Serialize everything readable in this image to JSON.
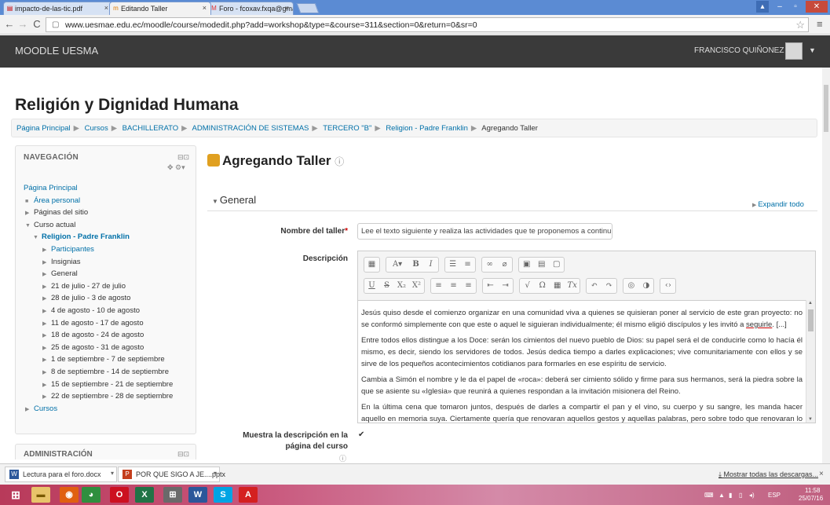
{
  "browser": {
    "tabs": [
      {
        "label": "impacto-de-las-tic.pdf",
        "icon": "pdf-icon"
      },
      {
        "label": "Editando Taller",
        "icon": "moodle-icon"
      },
      {
        "label": "Foro - fcoxav.fxqa@gmail",
        "icon": "gmail-icon"
      }
    ],
    "url": "www.uesmae.edu.ec/moodle/course/modedit.php?add=workshop&type=&course=311&section=0&return=0&sr=0",
    "close_glyph": "×"
  },
  "header": {
    "brand": "MOODLE UESMA",
    "user_name": "FRANCISCO QUIÑONEZ"
  },
  "course_title": "Religión y Dignidad Humana",
  "breadcrumb": [
    "Página Principal",
    "Cursos",
    "BACHILLERATO",
    "ADMINISTRACIÓN DE SISTEMAS",
    "TERCERO \"B\"",
    "Religion - Padre Franklin",
    "Agregando Taller"
  ],
  "navigation": {
    "title": "NAVEGACIÓN",
    "items": [
      {
        "label": "Página Principal",
        "indent": 0,
        "marker": "",
        "link": true
      },
      {
        "label": "Área personal",
        "indent": 1,
        "marker": "■",
        "link": true
      },
      {
        "label": "Páginas del sitio",
        "indent": 1,
        "marker": "▶",
        "link": false
      },
      {
        "label": "Curso actual",
        "indent": 1,
        "marker": "▼",
        "link": false
      },
      {
        "label": "Religion - Padre Franklin",
        "indent": 2,
        "marker": "▼",
        "link": true,
        "bold": true
      },
      {
        "label": "Participantes",
        "indent": 3,
        "marker": "▶",
        "link": true
      },
      {
        "label": "Insignias",
        "indent": 3,
        "marker": "▶",
        "link": false
      },
      {
        "label": "General",
        "indent": 3,
        "marker": "▶",
        "link": false
      },
      {
        "label": "21 de julio - 27 de julio",
        "indent": 3,
        "marker": "▶",
        "link": false
      },
      {
        "label": "28 de julio - 3 de agosto",
        "indent": 3,
        "marker": "▶",
        "link": false
      },
      {
        "label": "4 de agosto - 10 de agosto",
        "indent": 3,
        "marker": "▶",
        "link": false
      },
      {
        "label": "11 de agosto - 17 de agosto",
        "indent": 3,
        "marker": "▶",
        "link": false
      },
      {
        "label": "18 de agosto - 24 de agosto",
        "indent": 3,
        "marker": "▶",
        "link": false
      },
      {
        "label": "25 de agosto - 31 de agosto",
        "indent": 3,
        "marker": "▶",
        "link": false
      },
      {
        "label": "1 de septiembre - 7 de septiembre",
        "indent": 3,
        "marker": "▶",
        "link": false
      },
      {
        "label": "8 de septiembre - 14 de septiembre",
        "indent": 3,
        "marker": "▶",
        "link": false
      },
      {
        "label": "15 de septiembre - 21 de septiembre",
        "indent": 3,
        "marker": "▶",
        "link": false
      },
      {
        "label": "22 de septiembre - 28 de septiembre",
        "indent": 3,
        "marker": "▶",
        "link": false
      },
      {
        "label": "Cursos",
        "indent": 1,
        "marker": "▶",
        "link": true
      }
    ]
  },
  "admin_block_title": "ADMINISTRACIÓN",
  "page_title": "Agregando Taller",
  "expand_all": "Expandir todo",
  "section_general": "General",
  "form": {
    "name_label": "Nombre del taller",
    "name_value": "Lee el texto siguiente y realiza las actividades que te proponemos a continu",
    "description_label": "Descripción",
    "description_paragraphs": [
      {
        "pre": "Jesús quiso desde el comienzo organizar en una comunidad viva a quienes se quisieran poner al servicio de este gran proyecto: no se conformó simplemente con que este o aquel le siguieran individualmente; él mismo eligió discípulos y les invitó a ",
        "ul": "seguirle",
        "post": ". [...]"
      },
      {
        "pre": "Entre todos ellos distingue a los Doce: serán los cimientos del nuevo pueblo de Dios: su papel será el de conducirle como lo hacía él mismo, es decir, siendo los servidores de todos. Jesús dedica tiempo a darles explicaciones; vive comunitariamente con ellos y se sirve de los pequeños acontecimientos cotidianos para formarles en ese espíritu de servicio.",
        "ul": "",
        "post": ""
      },
      {
        "pre": "Cambia a Simón el nombre y le da el papel de «roca»: deberá ser cimiento sólido y firme para sus hermanos, será la piedra sobre la que se asiente su «Iglesia» que reunirá a quienes respondan a la invitación misionera del Reino.",
        "ul": "",
        "post": ""
      },
      {
        "pre": "En la última cena que tomaron juntos, después de darles a compartir el pan y el vino, su cuerpo y su sangre, les manda hacer aquello en memoria suya. Ciertamente quería que renovaran aquellos gestos y aquellas palabras, pero sobre todo que renovaran lo que",
        "ul": "",
        "post": ""
      }
    ],
    "show_description_label": "Muestra la descripción en la página del curso",
    "show_description_checked": true
  },
  "downloads": {
    "items": [
      "Lectura para el foro.docx",
      "POR QUE SIGO A JE....pptx"
    ],
    "show_all": "Mostrar todas las descargas..."
  },
  "taskbar": {
    "lang": "ESP",
    "time": "11:58",
    "date": "25/07/16"
  }
}
